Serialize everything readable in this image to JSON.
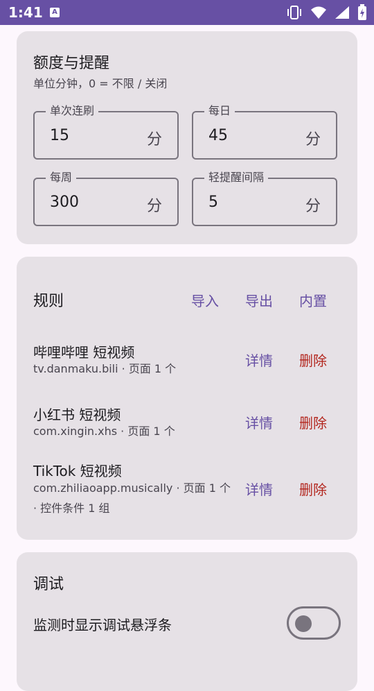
{
  "status_bar": {
    "time": "1:41",
    "notification_icon": "A",
    "icons": [
      "vibrate-icon",
      "wifi-icon",
      "signal-icon",
      "battery-charging-icon"
    ]
  },
  "quota": {
    "title": "额度与提醒",
    "subtitle": "单位分钟，0 = 不限 / 关闭",
    "fields": [
      {
        "label": "单次连刷",
        "value": "15",
        "suffix": "分"
      },
      {
        "label": "每日",
        "value": "45",
        "suffix": "分"
      },
      {
        "label": "每周",
        "value": "300",
        "suffix": "分"
      },
      {
        "label": "轻提醒间隔",
        "value": "5",
        "suffix": "分"
      }
    ]
  },
  "rules": {
    "title": "规则",
    "actions": {
      "import": "导入",
      "export": "导出",
      "builtin": "内置"
    },
    "detail_label": "详情",
    "delete_label": "删除",
    "items": [
      {
        "name": "哔哩哔哩 短视频",
        "desc": "tv.danmaku.bili · 页面 1 个"
      },
      {
        "name": "小红书 短视频",
        "desc": "com.xingin.xhs · 页面 1 个"
      },
      {
        "name": "TikTok 短视频",
        "desc": "com.zhiliaoapp.musically · 页面 1 个 · 控件条件 1 组"
      }
    ]
  },
  "debug": {
    "title": "调试",
    "toggle_label": "监测时显示调试悬浮条",
    "toggle_on": false
  },
  "colors": {
    "primary": "#6750a4",
    "danger": "#b3261e",
    "card": "#e6e1e6",
    "background": "#fdf7fd"
  }
}
